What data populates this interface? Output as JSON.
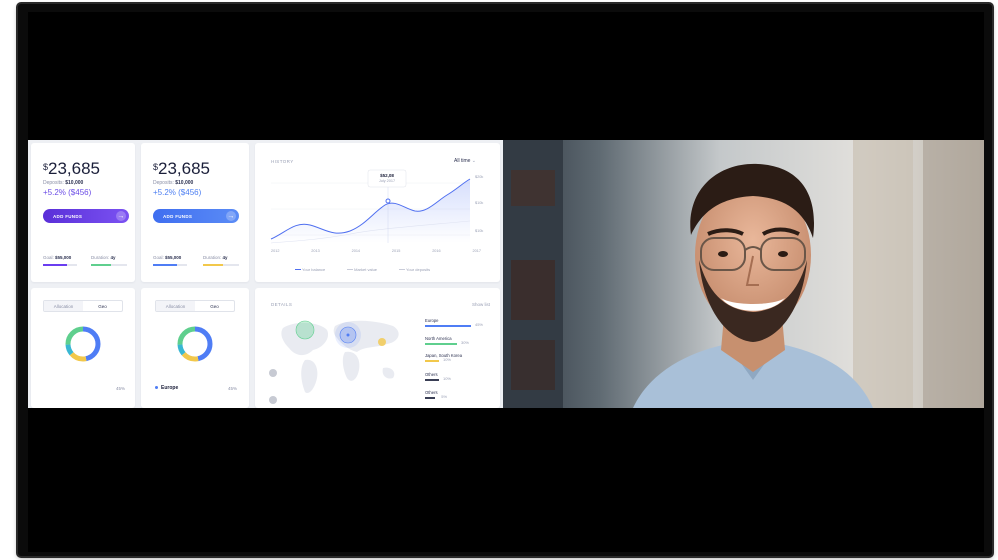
{
  "dashboard": {
    "card1": {
      "currency": "$",
      "amount": "23,685",
      "deposits_label": "Deposits:",
      "deposits_value": "$10,000",
      "gain": "+5.2% ($456)",
      "button": "ADD FUNDS",
      "goal_label": "Goal:",
      "goal_value": "$55,000",
      "duration_label": "Duration:",
      "duration_value": "4y"
    },
    "card2": {
      "currency": "$",
      "amount": "23,685",
      "deposits_label": "Deposits:",
      "deposits_value": "$10,000",
      "gain": "+5.2% ($456)",
      "button": "ADD FUNDS",
      "goal_label": "Goal:",
      "goal_value": "$55,000",
      "duration_label": "Duration:",
      "duration_value": "4y"
    },
    "history": {
      "title": "HISTORY",
      "range": "All time",
      "tooltip_value": "$52,08",
      "tooltip_date": "July 2017",
      "y_ticks": [
        "$20k",
        "$10k",
        "$10k"
      ],
      "x_ticks": [
        "2012",
        "2013",
        "2014",
        "2015",
        "2016",
        "2017"
      ],
      "legend": [
        "Your balance",
        "Market value",
        "Your deposits"
      ]
    },
    "allocation1": {
      "tabs": [
        "Allocation",
        "Geo"
      ],
      "percent": "45%"
    },
    "allocation2": {
      "tabs": [
        "Allocation",
        "Geo"
      ],
      "region": "Europe",
      "percent": "45%"
    },
    "details": {
      "title": "DETAILS",
      "link": "Show list",
      "regions": [
        {
          "name": "Europe",
          "pct": "45%"
        },
        {
          "name": "North America",
          "pct": "30%"
        },
        {
          "name": "Japan, South Korea",
          "pct": "10%"
        },
        {
          "name": "Others",
          "pct": "10%"
        },
        {
          "name": "Others",
          "pct": "5%"
        }
      ]
    }
  },
  "colors": {
    "purple": "#6a3df0",
    "blue": "#4f7df5",
    "green": "#5fcf8e",
    "yellow": "#f2c84b",
    "teal": "#39b7d3",
    "gain_purple": "#6b4de6",
    "gain_blue": "#4d7ff2"
  }
}
